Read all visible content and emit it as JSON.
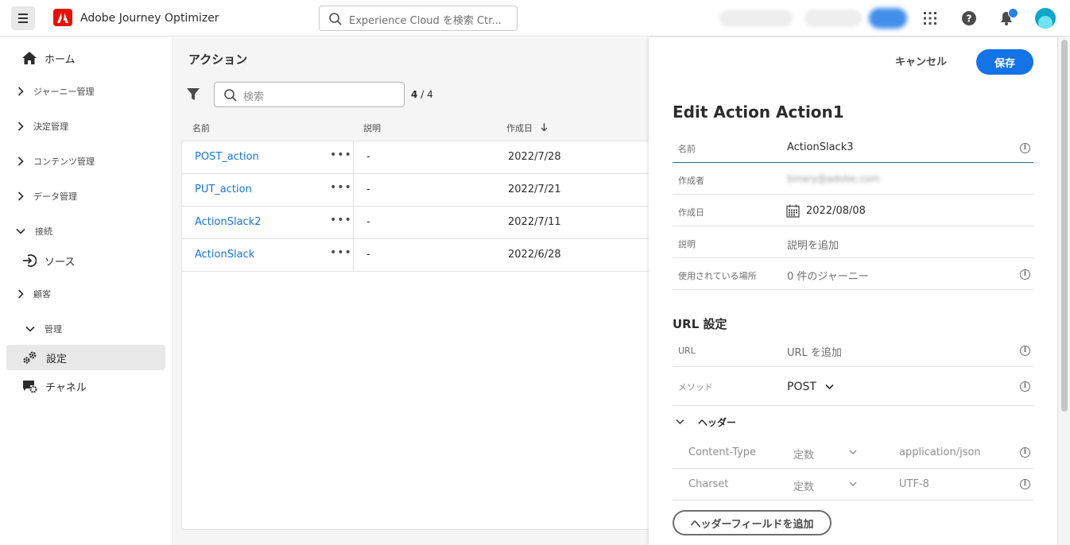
{
  "topbar": {
    "app_title": "Adobe Journey Optimizer",
    "search_placeholder": "Experience Cloud を検索 Ctr..."
  },
  "sidebar": {
    "items": [
      {
        "label": "ホーム",
        "icon": "home-icon"
      },
      {
        "label": "ジャーニー管理",
        "icon": "chevron-right-icon"
      },
      {
        "label": "決定管理",
        "icon": "chevron-right-icon"
      },
      {
        "label": "コンテンツ管理",
        "icon": "chevron-right-icon"
      },
      {
        "label": "データ管理",
        "icon": "chevron-right-icon"
      },
      {
        "label": "接続",
        "icon": "chevron-down-icon"
      },
      {
        "label": "ソース",
        "icon": "source-icon"
      },
      {
        "label": "顧客",
        "icon": "chevron-right-icon"
      },
      {
        "label": "管理",
        "icon": "chevron-down-icon"
      },
      {
        "label": "設定",
        "icon": "gear-icon"
      },
      {
        "label": "チャネル",
        "icon": "channel-icon"
      }
    ]
  },
  "list": {
    "title": "アクション",
    "search_placeholder": "検索",
    "count_shown": "4",
    "count_sep": "/",
    "count_total": "4",
    "columns": [
      "名前",
      "説明",
      "作成日"
    ],
    "rows": [
      {
        "name": "POST_action",
        "desc": "-",
        "date": "2022/7/28"
      },
      {
        "name": "PUT_action",
        "desc": "-",
        "date": "2022/7/21"
      },
      {
        "name": "ActionSlack2",
        "desc": "-",
        "date": "2022/7/11"
      },
      {
        "name": "ActionSlack",
        "desc": "-",
        "date": "2022/6/28"
      }
    ]
  },
  "panel": {
    "cancel_label": "キャンセル",
    "save_label": "保存",
    "title": "Edit Action Action1",
    "fields": {
      "name_label": "名前",
      "name_value": "ActionSlack3",
      "author_label": "作成者",
      "author_value": "binary@adobe.com",
      "created_label": "作成日",
      "created_value": "2022/08/08",
      "desc_label": "説明",
      "desc_value": "説明を追加",
      "used_label": "使用されている場所",
      "used_value": "0 件のジャーニー"
    },
    "url_section": {
      "title": "URL 設定",
      "url_label": "URL",
      "url_placeholder": "URL を追加",
      "method_label": "メソッド",
      "method_value": "POST"
    },
    "headers": {
      "title": "ヘッダー",
      "rows": [
        {
          "key": "Content-Type",
          "type": "定数",
          "value": "application/json"
        },
        {
          "key": "Charset",
          "type": "定数",
          "value": "UTF-8"
        }
      ],
      "add_label": "ヘッダーフィールドを追加"
    }
  }
}
